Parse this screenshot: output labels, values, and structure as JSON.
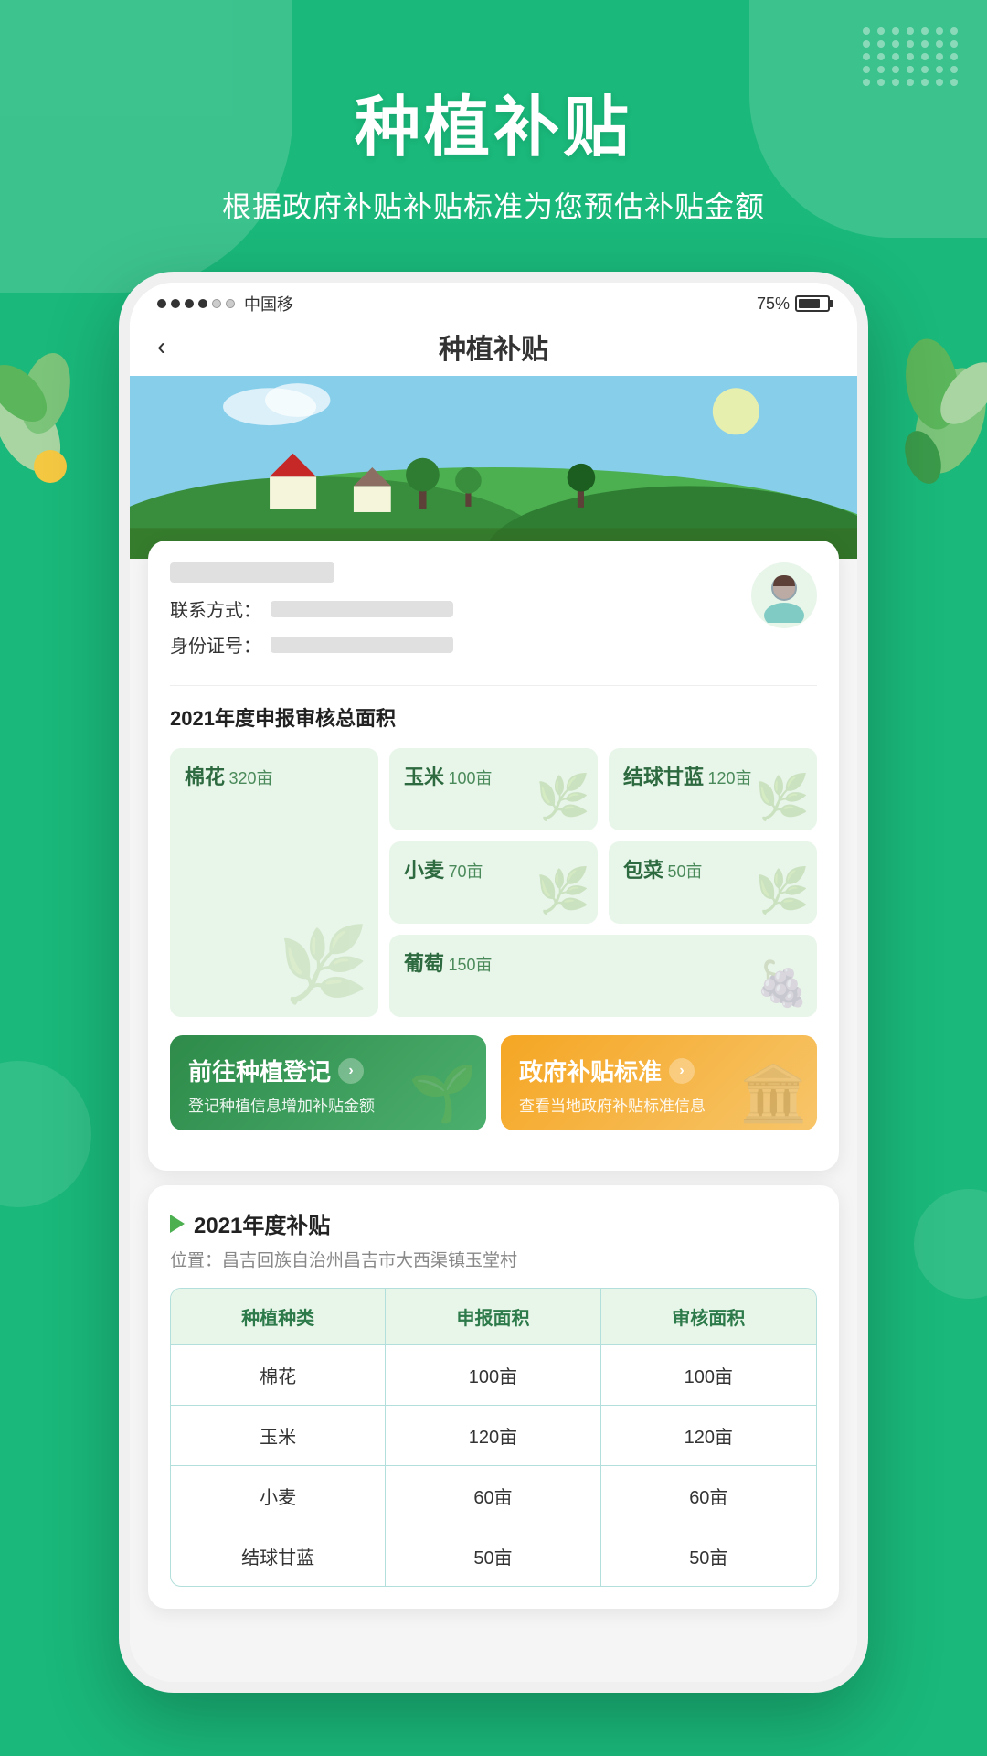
{
  "app": {
    "title": "种植补贴",
    "main_title": "种植补贴",
    "sub_title": "根据政府补贴补贴标准为您预估补贴金额"
  },
  "status_bar": {
    "carrier": "中国移",
    "battery_percent": "75%"
  },
  "nav": {
    "back_icon": "‹",
    "title": "种植补贴"
  },
  "user": {
    "contact_label": "联系方式：",
    "id_label": "身份证号："
  },
  "area_summary": {
    "title": "2021年度申报审核总面积",
    "crops": [
      {
        "name": "棉花",
        "area": "320亩",
        "large": true
      },
      {
        "name": "玉米",
        "area": "100亩",
        "large": false
      },
      {
        "name": "结球甘蓝",
        "area": "120亩",
        "large": false
      },
      {
        "name": "小麦",
        "area": "70亩",
        "large": false
      },
      {
        "name": "包菜",
        "area": "50亩",
        "large": false
      },
      {
        "name": "葡萄",
        "area": "150亩",
        "large": false
      }
    ]
  },
  "actions": {
    "register": {
      "title": "前往种植登记",
      "arrow": "›",
      "sub": "登记种植信息增加补贴金额"
    },
    "standard": {
      "title": "政府补贴标准",
      "arrow": "›",
      "sub": "查看当地政府补贴标准信息"
    }
  },
  "subsidy": {
    "year_label": "2021年度补贴",
    "location_prefix": "位置：",
    "location": "昌吉回族自治州昌吉市大西渠镇玉堂村",
    "table": {
      "headers": [
        "种植种类",
        "申报面积",
        "审核面积"
      ],
      "rows": [
        [
          "棉花",
          "100亩",
          "100亩"
        ],
        [
          "玉米",
          "120亩",
          "120亩"
        ],
        [
          "小麦",
          "60亩",
          "60亩"
        ],
        [
          "结球甘蓝",
          "50亩",
          "50亩"
        ]
      ]
    }
  },
  "colors": {
    "primary_green": "#1ab87a",
    "dark_green": "#2d6a3f",
    "light_green_bg": "#e8f5e9",
    "orange": "#f5a623",
    "table_border": "#b2dfdb",
    "table_header_bg": "#e8f5e9"
  }
}
